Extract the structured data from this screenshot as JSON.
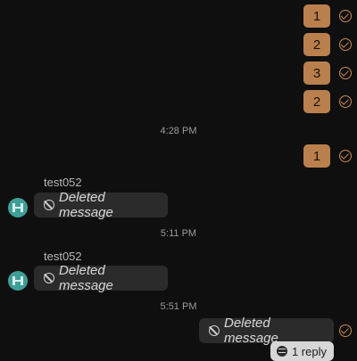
{
  "outgoing_top": [
    {
      "text": "1"
    },
    {
      "text": "2"
    },
    {
      "text": "3"
    },
    {
      "text": "2"
    }
  ],
  "time_1": "4:28 PM",
  "outgoing_after_time": {
    "text": "1"
  },
  "group_1": {
    "sender": "test052",
    "message": "Deleted message"
  },
  "time_2": "5:11 PM",
  "group_2": {
    "sender": "test052",
    "message": "Deleted message"
  },
  "time_3": "5:51 PM",
  "outgoing_deleted": {
    "message": "Deleted message"
  },
  "reply": {
    "label": "1 reply"
  },
  "colors": {
    "background": "#0f0f10",
    "outgoing_bubble": "#b9804d",
    "deleted_bubble": "#2b2b2b",
    "accent_check": "#c98a52",
    "avatar": "#3f9f98"
  }
}
